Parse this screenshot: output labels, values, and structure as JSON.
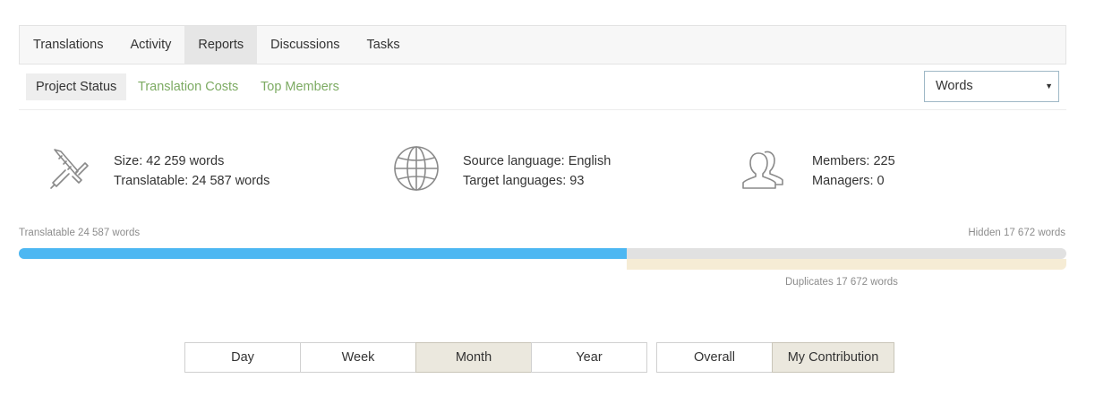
{
  "main_tabs": [
    {
      "label": "Translations",
      "active": false
    },
    {
      "label": "Activity",
      "active": false
    },
    {
      "label": "Reports",
      "active": true
    },
    {
      "label": "Discussions",
      "active": false
    },
    {
      "label": "Tasks",
      "active": false
    }
  ],
  "sub_tabs": {
    "project_status": "Project Status",
    "translation_costs": "Translation Costs",
    "top_members": "Top Members"
  },
  "unit_select": {
    "value": "Words",
    "arrow": "▼"
  },
  "stats": {
    "size": "Size: 42 259 words",
    "translatable": "Translatable: 24 587 words",
    "source_language": "Source language: English",
    "target_languages": "Target languages: 93",
    "members": "Members: 225",
    "managers": "Managers: 0"
  },
  "icons": {
    "size": "caliper-icon",
    "languages": "globe-icon",
    "members": "users-icon"
  },
  "progress": {
    "translatable_label": "Translatable 24 587 words",
    "hidden_label": "Hidden 17 672 words",
    "duplicates_label": "Duplicates 17 672 words",
    "translatable_fraction": 0.58
  },
  "period_buttons": [
    {
      "label": "Day",
      "active": false
    },
    {
      "label": "Week",
      "active": false
    },
    {
      "label": "Month",
      "active": true
    },
    {
      "label": "Year",
      "active": false
    }
  ],
  "scope_buttons": [
    {
      "label": "Overall",
      "active": false
    },
    {
      "label": "My Contribution",
      "active": true
    }
  ],
  "colors": {
    "accent_blue": "#4db7f2",
    "link_green": "#7dab63",
    "duplicates": "#f6ecd5",
    "active_button": "#ebe8de"
  }
}
